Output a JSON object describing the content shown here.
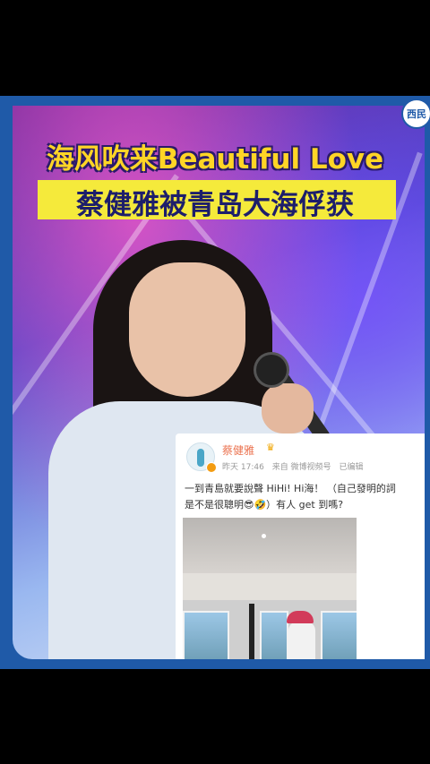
{
  "brand": {
    "logo_text": "西民"
  },
  "headline": {
    "line1": "海风吹来Beautiful Love",
    "line2": "蔡健雅被青岛大海俘获"
  },
  "post": {
    "username": "蔡健雅",
    "time": "昨天 17:46",
    "source": "来自 微博视频号",
    "edited": "已编辑",
    "text_line1": "一到青島就要說聲 HiHi! Hi海！ （自己發明的詞",
    "text_line2": "是不是很聰明😎🤣）有人 get 到嗎?"
  },
  "colors": {
    "frame_blue": "#1f5aa8",
    "headline_yellow": "#ffd526",
    "banner_yellow": "#f5ea3b",
    "username_orange": "#eb7350"
  }
}
